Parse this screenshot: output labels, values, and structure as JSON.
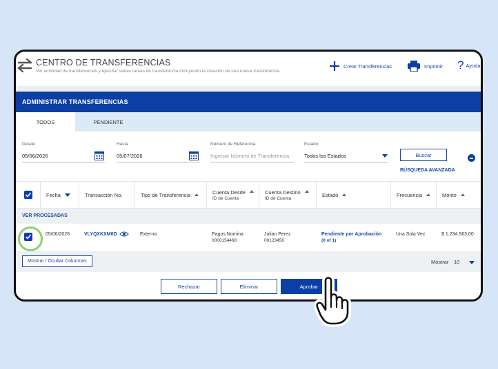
{
  "header": {
    "title": "CENTRO DE TRANSFERENCIAS",
    "subtitle": "Ver actividad de transferencias y ejecutar varias tareas de transferencia incluyendo la creación de una nueva transferencia.",
    "crear_label": "Crear Transferencias",
    "imprimir_label": "Imprimir",
    "ayuda_label": "Ayuda"
  },
  "section_title": "ADMINISTRAR TRANSFERENCIAS",
  "tabs": [
    {
      "label": "TODOS",
      "active": true
    },
    {
      "label": "PENDIENTE",
      "active": false
    }
  ],
  "filters": {
    "desde_label": "Desde",
    "desde_value": "05/06/2026",
    "hasta_label": "Hasta",
    "hasta_value": "05/07/2026",
    "ref_label": "Número de Referencia",
    "ref_placeholder": "Ingresar Número de Transferencia",
    "estado_label": "Estado",
    "estado_value": "Todos los Estados",
    "buscar_label": "Buscar",
    "avanzada_label": "BÚSQUEDA AVANZADA"
  },
  "table": {
    "columns": {
      "fecha": "Fecha",
      "transaccion": "Transacción No.",
      "tipo": "Tipo de Transferencia",
      "desde_l1": "Cuenta Desde",
      "desde_l2": "ID de Cuenta",
      "destino_l1": "Cuenta Destino",
      "destino_l2": "ID de Cuenta",
      "estado": "Estado",
      "frecuencia": "Frecuencia",
      "monto": "Monto"
    },
    "group_label": "VER PROCESADAS",
    "rows": [
      {
        "fecha": "05/06/2026",
        "transaccion": "VLYQXKXM6D",
        "tipo": "Externa",
        "desde_nombre": "Pagos Nomina",
        "desde_id": "0000154468",
        "destino_nombre": "Julian Perez",
        "destino_id": "00123456",
        "estado_l1": "Pendiente por Aprobación",
        "estado_l2": "(0 of 1)",
        "frecuencia": "Una Sola Vez",
        "monto": "$ 1.234.563,00"
      }
    ]
  },
  "footer": {
    "columns_button": "Mostrar / Ocultar Columnas",
    "mostrar_label": "Mostrar",
    "mostrar_value": "10"
  },
  "actions": {
    "rechazar": "Rechazar",
    "eliminar": "Eliminar",
    "aprobar": "Aprobar"
  },
  "colors": {
    "brand_blue": "#0b3fa3",
    "link_blue": "#1a4aa6",
    "highlight_green": "#8cd06a",
    "background": "#d6e6f8"
  }
}
